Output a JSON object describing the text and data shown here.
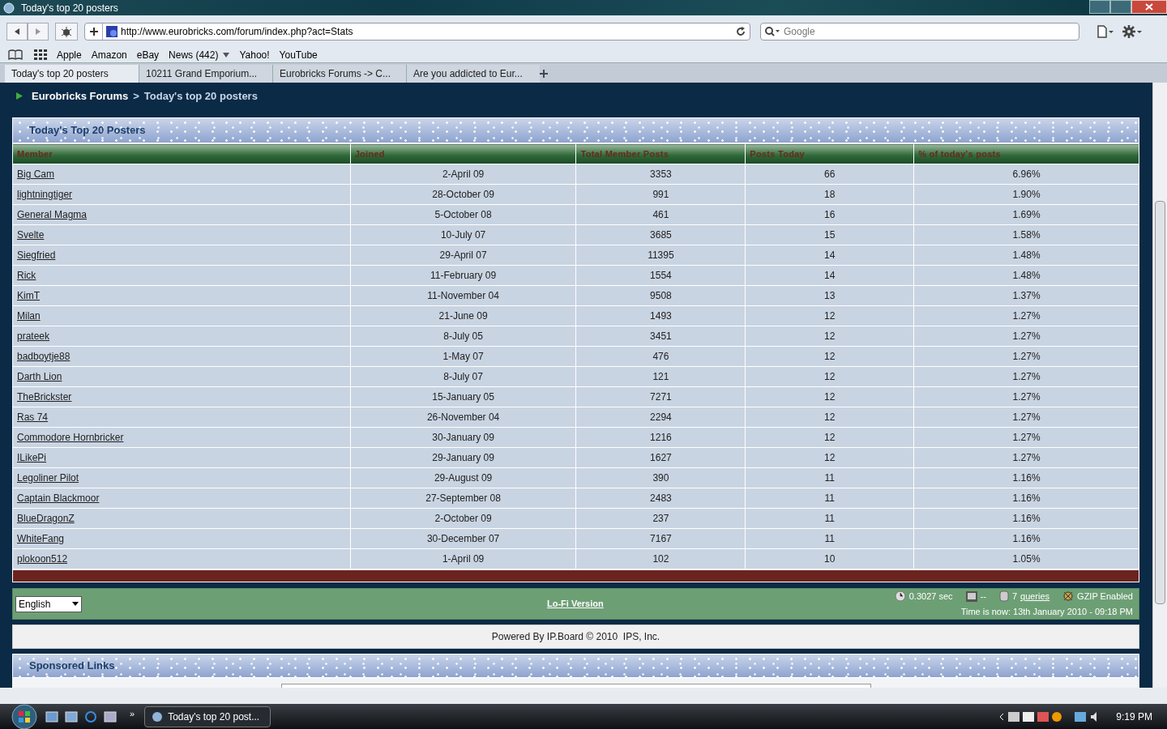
{
  "window": {
    "title": "Today's top 20 posters"
  },
  "toolbar": {
    "url": "http://www.eurobricks.com/forum/index.php?act=Stats",
    "search_placeholder": "Google"
  },
  "bookmarks": [
    "Apple",
    "Amazon",
    "eBay",
    "News (442)",
    "Yahoo!",
    "YouTube"
  ],
  "tabs": [
    {
      "label": "Today's top 20 posters",
      "selected": true
    },
    {
      "label": "10211 Grand Emporium...",
      "selected": false
    },
    {
      "label": "Eurobricks Forums -> C...",
      "selected": false
    },
    {
      "label": "Are you addicted to Eur...",
      "selected": false
    }
  ],
  "breadcrumb": {
    "parent": "Eurobricks Forums",
    "separator": ">",
    "current": "Today's top 20 posters"
  },
  "table": {
    "title": "Today's Top 20 Posters",
    "columns": [
      "Member",
      "Joined",
      "Total Member Posts",
      "Posts Today",
      "% of today's posts"
    ],
    "rows": [
      [
        "Big Cam",
        "2-April 09",
        "3353",
        "66",
        "6.96%"
      ],
      [
        "lightningtiger",
        "28-October 09",
        "991",
        "18",
        "1.90%"
      ],
      [
        "General Magma",
        "5-October 08",
        "461",
        "16",
        "1.69%"
      ],
      [
        "Svelte",
        "10-July 07",
        "3685",
        "15",
        "1.58%"
      ],
      [
        "Siegfried",
        "29-April 07",
        "11395",
        "14",
        "1.48%"
      ],
      [
        "Rick",
        "11-February 09",
        "1554",
        "14",
        "1.48%"
      ],
      [
        "KimT",
        "11-November 04",
        "9508",
        "13",
        "1.37%"
      ],
      [
        "Milan",
        "21-June 09",
        "1493",
        "12",
        "1.27%"
      ],
      [
        "prateek",
        "8-July 05",
        "3451",
        "12",
        "1.27%"
      ],
      [
        "badboytje88",
        "1-May 07",
        "476",
        "12",
        "1.27%"
      ],
      [
        "Darth Lion",
        "8-July 07",
        "121",
        "12",
        "1.27%"
      ],
      [
        "TheBrickster",
        "15-January 05",
        "7271",
        "12",
        "1.27%"
      ],
      [
        "Ras 74",
        "26-November 04",
        "2294",
        "12",
        "1.27%"
      ],
      [
        "Commodore Hornbricker",
        "30-January 09",
        "1216",
        "12",
        "1.27%"
      ],
      [
        "ILikePi",
        "29-January 09",
        "1627",
        "12",
        "1.27%"
      ],
      [
        "Legoliner Pilot",
        "29-August 09",
        "390",
        "11",
        "1.16%"
      ],
      [
        "Captain Blackmoor",
        "27-September 08",
        "2483",
        "11",
        "1.16%"
      ],
      [
        "BlueDragonZ",
        "2-October 09",
        "237",
        "11",
        "1.16%"
      ],
      [
        "WhiteFang",
        "30-December 07",
        "7167",
        "11",
        "1.16%"
      ],
      [
        "plokoon512",
        "1-April 09",
        "102",
        "10",
        "1.05%"
      ]
    ]
  },
  "footer": {
    "language": "English",
    "lofi": "Lo-Fi Version",
    "exec_time": "0.3027 sec",
    "load": "--",
    "queries_count": "7",
    "queries_link": "queries",
    "gzip": "GZIP Enabled",
    "time": "Time is now: 13th January 2010 - 09:18 PM"
  },
  "powered": "Powered By IP.Board © 2010  IPS, Inc.",
  "sponsored": {
    "title": "Sponsored Links"
  },
  "taskbar": {
    "window": "Today's top 20 post...",
    "clock": "9:19 PM",
    "chevron": "»"
  }
}
